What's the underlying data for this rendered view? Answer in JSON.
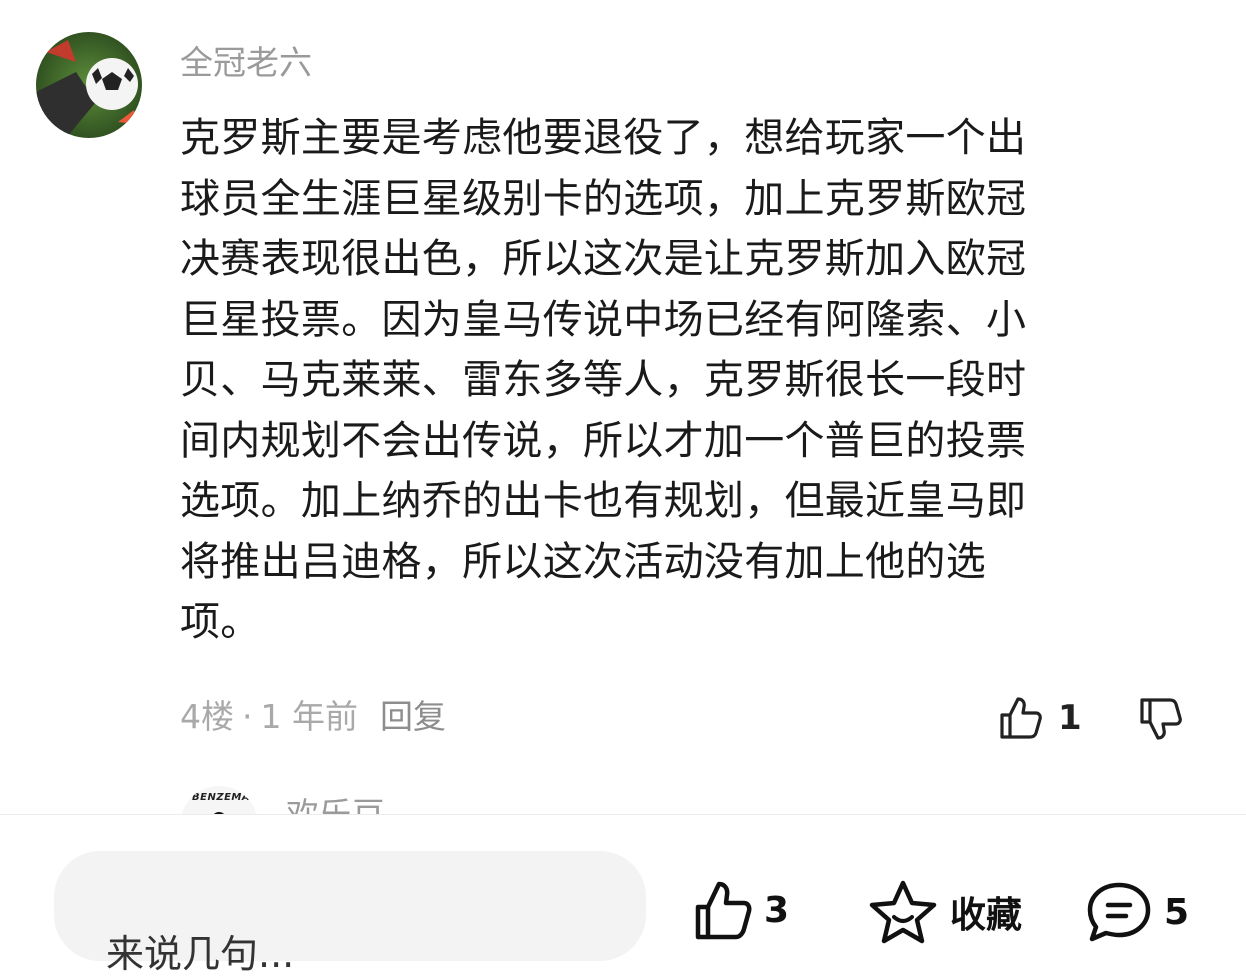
{
  "comment": {
    "username": "全冠老六",
    "avatar_icon": "football-avatar-icon",
    "lines": [
      "克罗斯主要是考虑他要退役了，想给玩家一个出",
      "球员全生涯巨星级别卡的选项，加上克罗斯欧冠",
      "决赛表现很出色，所以这次是让克罗斯加入欧冠",
      "巨星投票。因为皇马传说中场已经有阿隆索、小",
      "贝、马克莱莱、雷东多等人，克罗斯很长一段时",
      "间内规划不会出传说，所以才加一个普巨的投票",
      "选项。加上纳乔的出卡也有规划，但最近皇马即",
      "将推出吕迪格，所以这次活动没有加上他的选",
      "项。"
    ],
    "floor": "4楼",
    "separator": "·",
    "time": "1 年前",
    "reply_label": "回复",
    "like_count": "1"
  },
  "next_comment": {
    "username": "欢乐豆",
    "avatar_brand": "BENZEMA"
  },
  "bottom_bar": {
    "input_placeholder": "来说几句...",
    "like_count": "3",
    "favorite_label": "收藏",
    "comment_count": "5"
  },
  "colors": {
    "muted_text": "#9a9a9a",
    "body_text": "#1a1a1a",
    "input_bg": "#f3f3f3"
  }
}
